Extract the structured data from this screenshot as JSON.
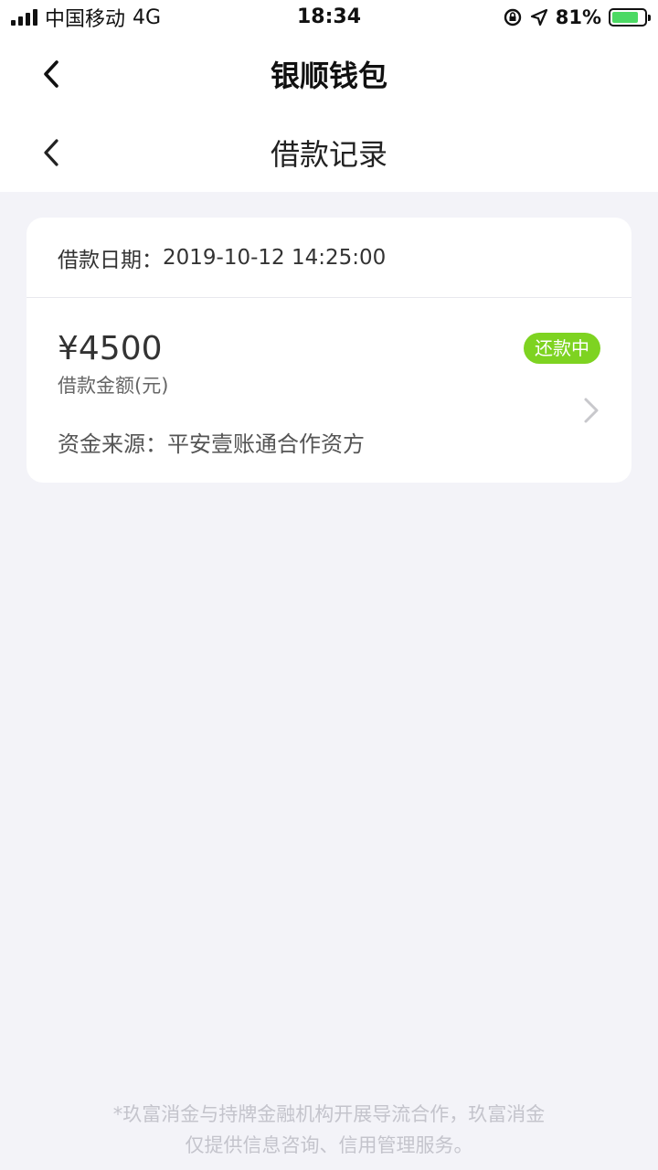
{
  "status_bar": {
    "carrier": "中国移动",
    "network": "4G",
    "time": "18:34",
    "battery_percent": "81%",
    "battery_level": 0.81,
    "icons": [
      "signal-icon",
      "orientation-lock-icon",
      "location-icon",
      "battery-icon"
    ]
  },
  "header": {
    "app_title": "银顺钱包",
    "page_title": "借款记录"
  },
  "loan": {
    "date_label": "借款日期：",
    "date_value": "2019-10-12 14:25:00",
    "amount": "¥4500",
    "amount_label": "借款金额(元)",
    "status": "还款中",
    "source_label": "资金来源：",
    "source_value": "平安壹账通合作资方"
  },
  "footer": {
    "line1": "*玖富消金与持牌金融机构开展导流合作，玖富消金",
    "line2": "仅提供信息咨询、信用管理服务。"
  },
  "colors": {
    "accent_green": "#7ed321",
    "background": "#f3f3f8",
    "battery_green": "#4cd964"
  }
}
